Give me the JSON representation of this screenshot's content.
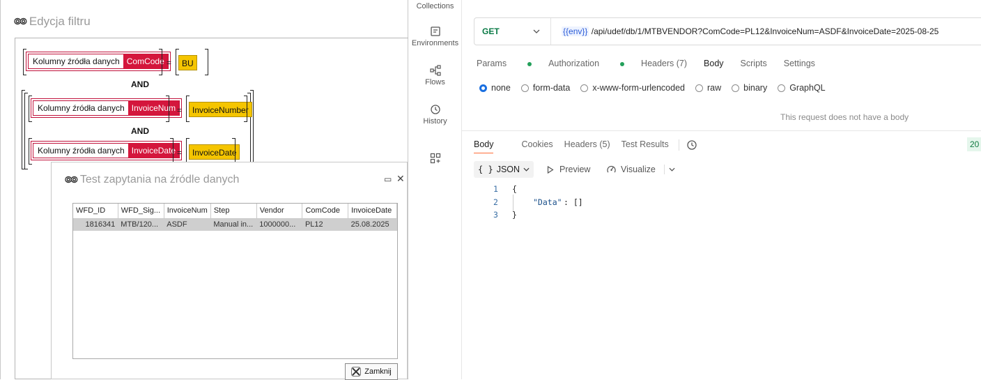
{
  "filter_window": {
    "title": "Edycja filtru",
    "conditions": [
      {
        "label": "Kolumny źródła danych",
        "column": "ComCode",
        "operator": "=",
        "value": "BU"
      },
      {
        "label": "Kolumny źródła danych",
        "column": "InvoiceNum",
        "operator": "=",
        "value": "InvoiceNumber"
      },
      {
        "label": "Kolumny źródła danych",
        "column": "InvoiceDate",
        "operator": "=",
        "value": "InvoiceDate"
      }
    ],
    "joiners": [
      "AND",
      "AND"
    ]
  },
  "test_dialog": {
    "title": "Test zapytania na źródle danych",
    "columns": [
      "WFD_ID",
      "WFD_Sig...",
      "InvoiceNum",
      "Step",
      "Vendor",
      "ComCode",
      "InvoiceDate"
    ],
    "rows": [
      [
        "1816341",
        "MTB/120...",
        "ASDF",
        "Manual in...",
        "1000000...",
        "PL12",
        "25.08.2025"
      ]
    ],
    "close_label": "Zamknij"
  },
  "sidebar": {
    "items": [
      {
        "label": "Collections",
        "icon": "collections-icon"
      },
      {
        "label": "Environments",
        "icon": "environments-icon"
      },
      {
        "label": "Flows",
        "icon": "flows-icon"
      },
      {
        "label": "History",
        "icon": "history-icon"
      },
      {
        "label": "",
        "icon": "add-workbench-icon"
      }
    ]
  },
  "request": {
    "method": "GET",
    "url_env": "{{env}}",
    "url_path": "/api/udef/db/1/MTBVENDOR?ComCode=PL12&InvoiceNum=ASDF&InvoiceDate=2025-08-25",
    "tabs": [
      "Params",
      "Authorization",
      "Headers (7)",
      "Body",
      "Scripts",
      "Settings"
    ],
    "active_tab": "Body",
    "body_modes": [
      "none",
      "form-data",
      "x-www-form-urlencoded",
      "raw",
      "binary",
      "GraphQL"
    ],
    "selected_body_mode": "none",
    "no_body_message": "This request does not have a body"
  },
  "response": {
    "tabs": [
      "Body",
      "Cookies",
      "Headers (5)",
      "Test Results"
    ],
    "active_tab": "Body",
    "status_partial": "20",
    "format": "JSON",
    "preview_label": "Preview",
    "visualize_label": "Visualize",
    "lines": [
      {
        "num": "1",
        "text": "{"
      },
      {
        "num": "2",
        "key": "\"Data\"",
        "rest": ": []"
      },
      {
        "num": "3",
        "text": "}"
      }
    ]
  },
  "colors": {
    "accent_red": "#d4163c",
    "value_yellow": "#f5c500",
    "postman_orange": "#ff6c37",
    "get_green": "#0a7a46"
  }
}
